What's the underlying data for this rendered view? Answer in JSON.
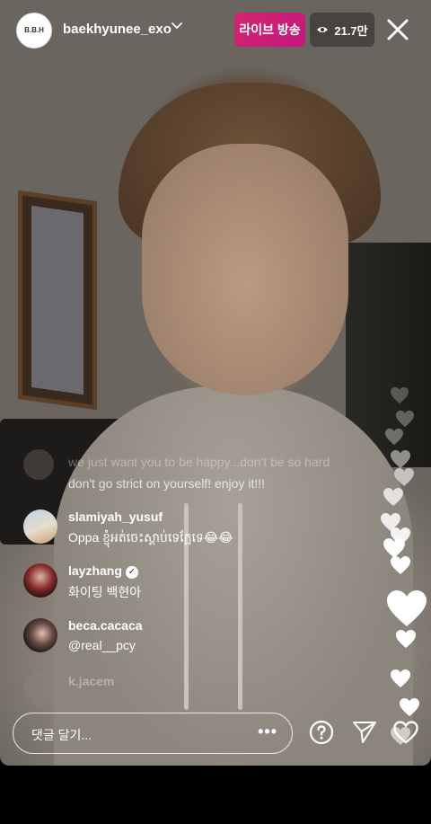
{
  "header": {
    "avatar_text": "B.B.H",
    "username": "baekhyunee_exo",
    "live_label": "라이브 방송",
    "viewer_count": "21.7만"
  },
  "comments": [
    {
      "username": "",
      "text": "we just want you to be happy...don't be so hard"
    },
    {
      "username": "",
      "text": "don't go strict on yourself! enjoy it!!!"
    },
    {
      "username": "slamiyah_yusuf",
      "text": "Oppa ខ្ញុំអត់ចេះស្តាប់ទេក្អែទេ😂😂"
    },
    {
      "username": "layzhang",
      "text": "화이팅 백현아",
      "verified": true
    },
    {
      "username": "beca.cacaca",
      "text": "@real__pcy"
    },
    {
      "username": "k.jacem",
      "text": ""
    }
  ],
  "composer": {
    "placeholder": "댓글 달기...",
    "more_label": "•••"
  },
  "icons": {
    "close": "close-icon",
    "eye": "eye-icon",
    "question": "question-icon",
    "send": "send-icon",
    "like": "heart-icon",
    "dropdown": "chevron-down-icon"
  },
  "colors": {
    "live_badge": "#d2266d",
    "text": "#ffffff"
  }
}
